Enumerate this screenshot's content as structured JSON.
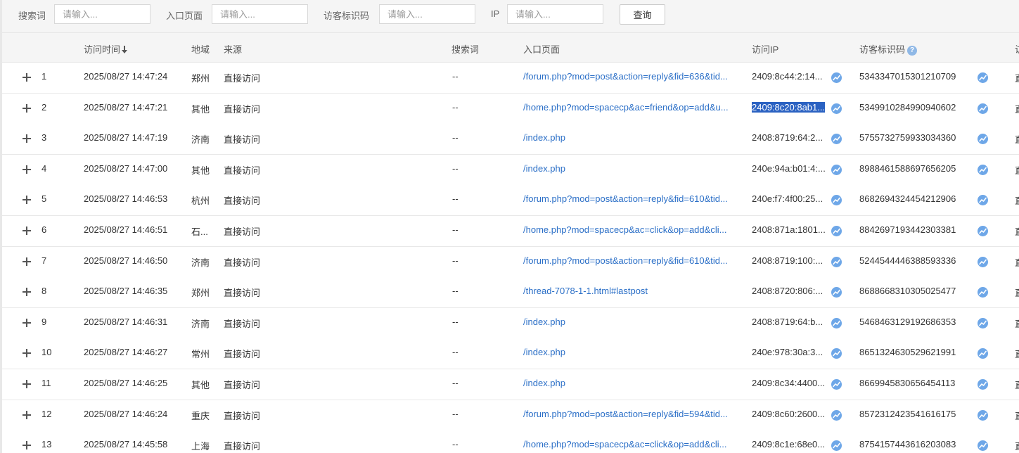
{
  "filters": {
    "search_label": "搜索词",
    "search_placeholder": "请输入...",
    "entry_label": "入口页面",
    "entry_placeholder": "请输入...",
    "visitor_label": "访客标识码",
    "visitor_placeholder": "请输入...",
    "ip_label": "IP",
    "ip_placeholder": "请输入...",
    "query_button": "查询"
  },
  "table": {
    "headers": {
      "time": "访问时间",
      "region": "地域",
      "source": "来源",
      "keyword": "搜索词",
      "entry": "入口页面",
      "ip": "访问IP",
      "visitor_id": "访客标识码",
      "edge": "访"
    },
    "rows": [
      {
        "index": "1",
        "time": "2025/08/27 14:47:24",
        "region": "郑州",
        "source": "直接访问",
        "keyword": "--",
        "entry": "/forum.php?mod=post&action=reply&fid=636&tid...",
        "ip": "2409:8c44:2:14...",
        "ip_selected": false,
        "visitor_id": "5343347015301210709",
        "edge": "直"
      },
      {
        "index": "2",
        "time": "2025/08/27 14:47:21",
        "region": "其他",
        "source": "直接访问",
        "keyword": "--",
        "entry": "/home.php?mod=spacecp&ac=friend&op=add&u...",
        "ip": "2409:8c20:8ab1...",
        "ip_selected": true,
        "visitor_id": "5349910284990940602",
        "edge": "直"
      },
      {
        "index": "3",
        "time": "2025/08/27 14:47:19",
        "region": "济南",
        "source": "直接访问",
        "keyword": "--",
        "entry": "/index.php",
        "ip": "2408:8719:64:2...",
        "ip_selected": false,
        "visitor_id": "5755732759933034360",
        "edge": "直"
      },
      {
        "index": "4",
        "time": "2025/08/27 14:47:00",
        "region": "其他",
        "source": "直接访问",
        "keyword": "--",
        "entry": "/index.php",
        "ip": "240e:94a:b01:4:...",
        "ip_selected": false,
        "visitor_id": "8988461588697656205",
        "edge": "直"
      },
      {
        "index": "5",
        "time": "2025/08/27 14:46:53",
        "region": "杭州",
        "source": "直接访问",
        "keyword": "--",
        "entry": "/forum.php?mod=post&action=reply&fid=610&tid...",
        "ip": "240e:f7:4f00:25...",
        "ip_selected": false,
        "visitor_id": "8682694324454212906",
        "edge": "直"
      },
      {
        "index": "6",
        "time": "2025/08/27 14:46:51",
        "region": "石...",
        "source": "直接访问",
        "keyword": "--",
        "entry": "/home.php?mod=spacecp&ac=click&op=add&cli...",
        "ip": "2408:871a:1801...",
        "ip_selected": false,
        "visitor_id": "8842697193442303381",
        "edge": "直"
      },
      {
        "index": "7",
        "time": "2025/08/27 14:46:50",
        "region": "济南",
        "source": "直接访问",
        "keyword": "--",
        "entry": "/forum.php?mod=post&action=reply&fid=610&tid...",
        "ip": "2408:8719:100:...",
        "ip_selected": false,
        "visitor_id": "5244544446388593336",
        "edge": "直"
      },
      {
        "index": "8",
        "time": "2025/08/27 14:46:35",
        "region": "郑州",
        "source": "直接访问",
        "keyword": "--",
        "entry": "/thread-7078-1-1.html#lastpost",
        "ip": "2408:8720:806:...",
        "ip_selected": false,
        "visitor_id": "8688668310305025477",
        "edge": "直"
      },
      {
        "index": "9",
        "time": "2025/08/27 14:46:31",
        "region": "济南",
        "source": "直接访问",
        "keyword": "--",
        "entry": "/index.php",
        "ip": "2408:8719:64:b...",
        "ip_selected": false,
        "visitor_id": "5468463129192686353",
        "edge": "直"
      },
      {
        "index": "10",
        "time": "2025/08/27 14:46:27",
        "region": "常州",
        "source": "直接访问",
        "keyword": "--",
        "entry": "/index.php",
        "ip": "240e:978:30a:3...",
        "ip_selected": false,
        "visitor_id": "8651324630529621991",
        "edge": "直"
      },
      {
        "index": "11",
        "time": "2025/08/27 14:46:25",
        "region": "其他",
        "source": "直接访问",
        "keyword": "--",
        "entry": "/index.php",
        "ip": "2409:8c34:4400...",
        "ip_selected": false,
        "visitor_id": "8669945830656454113",
        "edge": "直"
      },
      {
        "index": "12",
        "time": "2025/08/27 14:46:24",
        "region": "重庆",
        "source": "直接访问",
        "keyword": "--",
        "entry": "/forum.php?mod=post&action=reply&fid=594&tid...",
        "ip": "2409:8c60:2600...",
        "ip_selected": false,
        "visitor_id": "8572312423541616175",
        "edge": "直"
      },
      {
        "index": "13",
        "time": "2025/08/27 14:45:58",
        "region": "上海",
        "source": "直接访问",
        "keyword": "--",
        "entry": "/home.php?mod=spacecp&ac=click&op=add&cli...",
        "ip": "2409:8c1e:68e0...",
        "ip_selected": false,
        "visitor_id": "8754157443616203083",
        "edge": "直"
      }
    ]
  },
  "colors": {
    "link": "#2b6fc7",
    "selection": "#2b62c2",
    "trend_icon": "#6ea7e8",
    "header_bg": "#f5f5f5"
  },
  "icons": {
    "sort": "arrow-down-icon",
    "help": "question-circle-icon",
    "trend": "trend-chart-icon",
    "expand": "plus-icon"
  }
}
